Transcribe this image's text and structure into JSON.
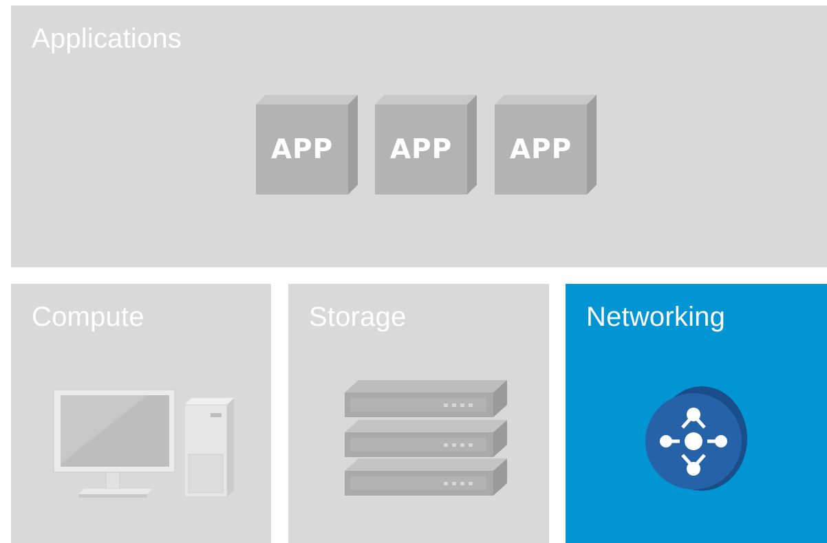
{
  "applications": {
    "title": "Applications",
    "apps": [
      {
        "label": "APP"
      },
      {
        "label": "APP"
      },
      {
        "label": "APP"
      }
    ]
  },
  "compute": {
    "title": "Compute",
    "icon": "desktop-computer-icon"
  },
  "storage": {
    "title": "Storage",
    "icon": "server-stack-icon"
  },
  "networking": {
    "title": "Networking",
    "icon": "network-topology-icon"
  },
  "colors": {
    "panel_gray": "#d9d9d9",
    "networking_blue": "#0195d3",
    "node_blue": "#1f5da0",
    "app_block": "#b3b3b3"
  }
}
